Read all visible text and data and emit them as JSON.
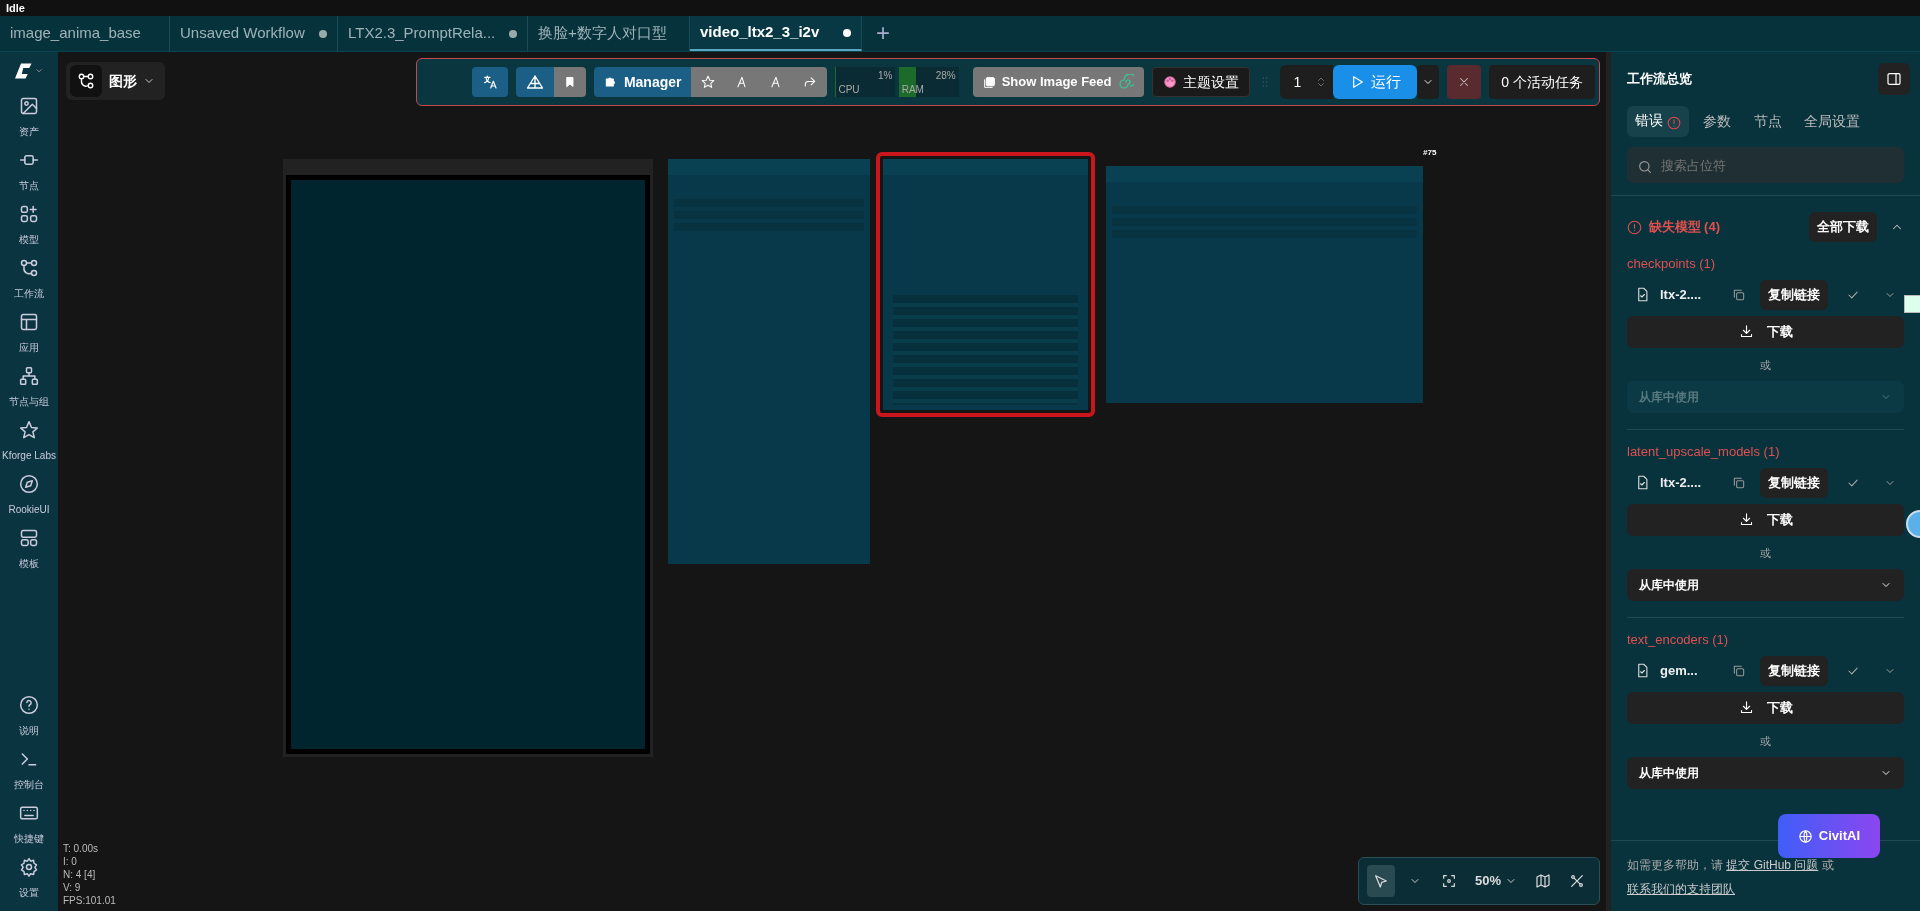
{
  "status": "Idle",
  "tabs": [
    {
      "label": "image_anima_base",
      "selected": false,
      "unsaved": false
    },
    {
      "label": "Unsaved Workflow",
      "selected": false,
      "unsaved": true
    },
    {
      "label": "LTX2.3_PromptRela...",
      "selected": false,
      "unsaved": true
    },
    {
      "label": "换脸+数字人对口型",
      "selected": false,
      "unsaved": false
    },
    {
      "label": "video_ltx2_3_i2v",
      "selected": true,
      "unsaved": true
    }
  ],
  "new_tab": "+",
  "sidebar": {
    "items": [
      {
        "label": "资产",
        "kind": "image"
      },
      {
        "label": "节点",
        "kind": "node"
      },
      {
        "label": "模型",
        "kind": "models"
      },
      {
        "label": "工作流",
        "kind": "workflow"
      },
      {
        "label": "应用",
        "kind": "layout"
      },
      {
        "label": "节点与组",
        "kind": "tree"
      },
      {
        "label": "Kforge Labs",
        "kind": "star"
      },
      {
        "label": "RookieUI",
        "kind": "compass"
      },
      {
        "label": "模板",
        "kind": "template"
      }
    ],
    "bottom_items": [
      {
        "label": "说明",
        "kind": "help"
      },
      {
        "label": "控制台",
        "kind": "terminal"
      },
      {
        "label": "快捷键",
        "kind": "keyboard"
      },
      {
        "label": "设置",
        "kind": "gear"
      }
    ]
  },
  "graph_menu": {
    "label": "图形"
  },
  "toolbar": {
    "manager": "Manager",
    "meters": [
      {
        "label": "CPU",
        "reading": "1%",
        "level": 0.01
      },
      {
        "label": "RAM",
        "reading": "28%",
        "level": 0.28
      }
    ],
    "image_feed": "Show Image Feed",
    "theme": "主题设置",
    "batch": "1",
    "run": "运行",
    "queue": "0 个活动任务"
  },
  "canvas": {
    "nodes": [
      {
        "kind": "preview",
        "selected": false
      },
      {
        "kind": "panel",
        "selected": false
      },
      {
        "kind": "panel",
        "selected": true
      },
      {
        "kind": "panel",
        "selected": false
      }
    ],
    "node_id": "#75"
  },
  "stats": [
    "T: 0.00s",
    "I: 0",
    "N: 4 [4]",
    "V: 9",
    "FPS:101.01"
  ],
  "canvas_controls": {
    "zoom": "50%"
  },
  "panel": {
    "title": "工作流总览",
    "tabs": [
      {
        "label": "错误",
        "selected": true,
        "error": true
      },
      {
        "label": "参数",
        "selected": false,
        "error": false
      },
      {
        "label": "节点",
        "selected": false,
        "error": false
      },
      {
        "label": "全局设置",
        "selected": false,
        "error": false
      }
    ],
    "search": {
      "placeholder": "搜索占位符"
    },
    "section": {
      "title": "缺失模型 (4)",
      "action": "全部下载",
      "expanded": true
    },
    "groups": [
      {
        "title": "checkpoints (1)",
        "file": "ltx-2....",
        "copy": "复制链接",
        "download": "下载",
        "or": "或",
        "library": {
          "label": "从库中使用",
          "disabled": true
        }
      },
      {
        "title": "latent_upscale_models (1)",
        "file": "ltx-2....",
        "copy": "复制链接",
        "download": "下载",
        "or": "或",
        "library": {
          "label": "从库中使用",
          "disabled": false
        }
      },
      {
        "title": "text_encoders (1)",
        "file": "gem...",
        "copy": "复制链接",
        "download": "下载",
        "or": "或",
        "library": {
          "label": "从库中使用",
          "disabled": false
        }
      }
    ],
    "help": {
      "text": "如需更多帮助，请",
      "link": "提交 GitHub 问题",
      "joiner": "或",
      "link2": "联系我们的支持团队"
    },
    "civitai": "CivitAI"
  }
}
